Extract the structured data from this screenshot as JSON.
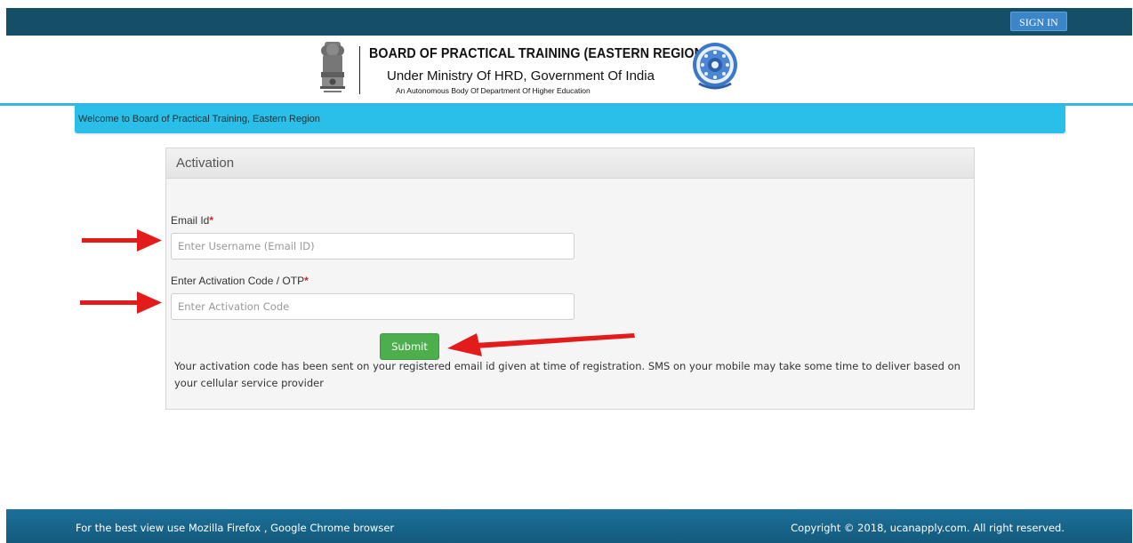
{
  "nav": {
    "sign_in_label": "SIGN IN"
  },
  "header": {
    "title": "BOARD OF PRACTICAL TRAINING (EASTERN REGION)",
    "subtitle": "Under Ministry Of HRD, Government Of India",
    "tagline": "An Autonomous Body Of Department Of Higher Education",
    "emblem_icon": "national-emblem-icon",
    "seal_icon": "bopt-seal-icon"
  },
  "welcome": {
    "text": "Welcome to Board of Practical Training, Eastern Region"
  },
  "panel": {
    "title": "Activation",
    "email_label": "Email Id",
    "email_placeholder": "Enter Username (Email ID)",
    "email_value": "",
    "code_label": "Enter Activation Code / OTP",
    "code_placeholder": "Enter Activation Code",
    "code_value": "",
    "required_mark": "*",
    "submit_label": "Submit",
    "note": "Your activation code has been sent on your registered email id given at time of registration. SMS on your mobile may take some time to deliver based on your cellular service provider"
  },
  "footer": {
    "left": "For the best view use Mozilla Firefox , Google Chrome browser",
    "right": "Copyright © 2018, ucanapply.com. All right reserved."
  },
  "colors": {
    "navbar": "#154f67",
    "banner": "#29bfe8",
    "submit": "#4cae4c",
    "arrow": "#e41b1b",
    "footer": "#1d7099"
  }
}
